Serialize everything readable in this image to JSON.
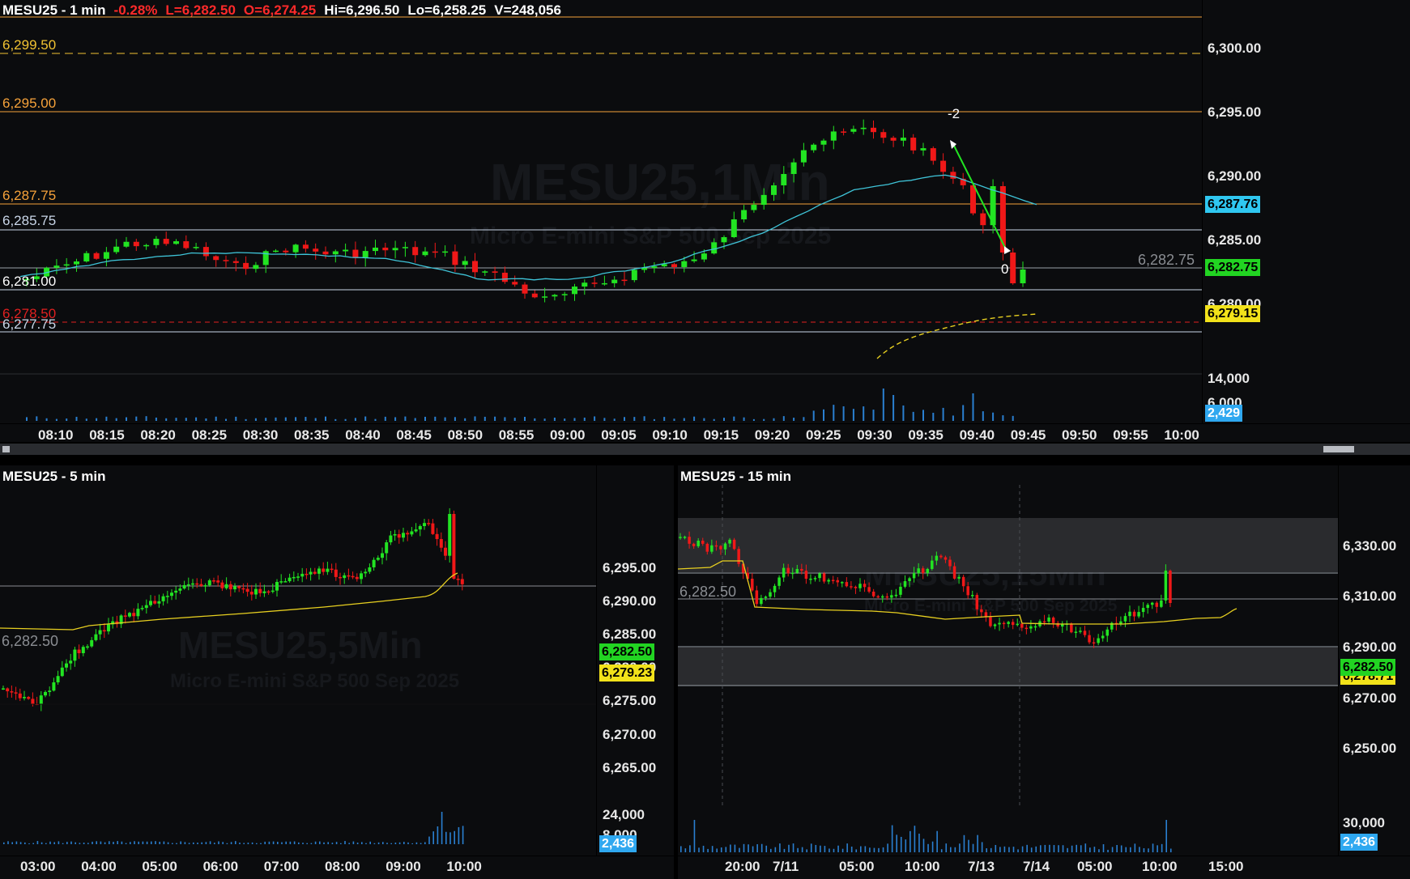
{
  "main": {
    "title": "MESU25 - 1 min",
    "change": "-0.28%",
    "last": "L=6,282.50",
    "open": "O=6,274.25",
    "high": "Hi=6,296.50",
    "low": "Lo=6,258.25",
    "volume": "V=248,056",
    "watermark_symbol": "MESU25,1Min",
    "watermark_desc": "Micro E-mini S&P 500 Sep 2025",
    "price_ticks": [
      "6,300.00",
      "6,295.00",
      "6,290.00",
      "6,285.00",
      "6,280.00"
    ],
    "volume_ticks": [
      "14,000",
      "6,000"
    ],
    "time_ticks": [
      "08:10",
      "08:15",
      "08:20",
      "08:25",
      "08:30",
      "08:35",
      "08:40",
      "08:45",
      "08:50",
      "08:55",
      "09:00",
      "09:05",
      "09:10",
      "09:15",
      "09:20",
      "09:25",
      "09:30",
      "09:35",
      "09:40",
      "09:45",
      "09:50",
      "09:55",
      "10:00"
    ],
    "level_labels": [
      {
        "text": "6,299.50",
        "color": "#f1c232"
      },
      {
        "text": "6,295.00",
        "color": "#f6a23a"
      },
      {
        "text": "6,287.75",
        "color": "#f6a23a"
      },
      {
        "text": "6,285.75",
        "color": "#c9d6e8"
      },
      {
        "text": "6,281.00",
        "color": "#ffffff"
      },
      {
        "text": "6,278.50",
        "color": "#e02020"
      },
      {
        "text": "6,277.75",
        "color": "#c9d6e8"
      }
    ],
    "last_price_ghost": "6,282.75",
    "tags": [
      {
        "text": "6,287.76",
        "bg": "#2fc7f0"
      },
      {
        "text": "6,282.75",
        "bg": "#22d422"
      },
      {
        "text": "6,279.15",
        "bg": "#f2e21a"
      },
      {
        "text": "2,429",
        "bg": "#2fa8f0"
      }
    ],
    "trade_labels": [
      "-2",
      "0"
    ],
    "colors": {
      "up": "#22e422",
      "down": "#f01818",
      "ma": "#3fc4d8",
      "vwap": "#e8d020"
    }
  },
  "left": {
    "title": "MESU25 - 5 min",
    "watermark_symbol": "MESU25,5Min",
    "watermark_desc": "Micro E-mini S&P 500 Sep 2025",
    "price_ticks": [
      "6,295.00",
      "6,290.00",
      "6,285.00",
      "6,280.00",
      "6,275.00",
      "6,270.00",
      "6,265.00"
    ],
    "volume_ticks": [
      "24,000",
      "8,000"
    ],
    "time_ticks": [
      "03:00",
      "04:00",
      "05:00",
      "06:00",
      "07:00",
      "08:00",
      "09:00",
      "10:00"
    ],
    "last_label": "6,282.50",
    "tags": [
      {
        "text": "6,282.50",
        "bg": "#22d422"
      },
      {
        "text": "6,279.23",
        "bg": "#f2e21a"
      },
      {
        "text": "2,436",
        "bg": "#2fa8f0"
      }
    ]
  },
  "right": {
    "title": "MESU25 - 15 min",
    "watermark_symbol": "MESU25,15Min",
    "watermark_desc": "Micro E-mini S&P 500 Sep 2025",
    "price_ticks": [
      "6,330.00",
      "6,310.00",
      "6,290.00",
      "6,270.00",
      "6,250.00"
    ],
    "volume_ticks": [
      "30,000"
    ],
    "time_ticks": [
      "20:00",
      "7/11",
      "05:00",
      "10:00",
      "7/13",
      "7/14",
      "05:00",
      "10:00",
      "15:00"
    ],
    "last_label": "6,282.50",
    "tags": [
      {
        "text": "6,282.50",
        "bg": "#22d422"
      },
      {
        "text": "6,278.71",
        "bg": "#f2e21a"
      },
      {
        "text": "2,436",
        "bg": "#2fa8f0"
      }
    ]
  }
}
